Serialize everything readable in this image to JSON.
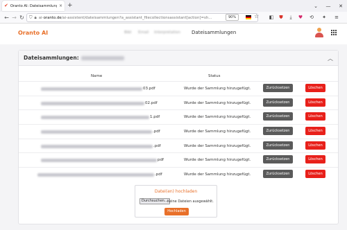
{
  "browser": {
    "tab_title": "Oranto AI: Dateisammlungen d...",
    "tab_close": "×",
    "new_tab": "+",
    "url_prefix": "ai-",
    "url_domain": "oranto.de",
    "url_rest": "/ai-assistent/dateisammlungen?a_assistant_filecollectionsassistant[action]=sh...",
    "zoom": "90%"
  },
  "app": {
    "brand": "Oranto AI",
    "nav": [
      "Bibl",
      "Email",
      "Interpretation"
    ],
    "active_nav": "Dateisammlungen"
  },
  "card": {
    "title": "Dateisammlungen:",
    "col_name": "Name",
    "col_status": "Status"
  },
  "rows": [
    {
      "suffix": "03.pdf",
      "status": "Wurde der Sammlung hinzugefügt.",
      "reset": "Zurücksetzen",
      "delete": "Löschen"
    },
    {
      "suffix": "02.pdf",
      "status": "Wurde der Sammlung hinzugefügt.",
      "reset": "Zurücksetzen",
      "delete": "Löschen"
    },
    {
      "suffix": "1.pdf",
      "status": "Wurde der Sammlung hinzugefügt.",
      "reset": "Zurücksetzen",
      "delete": "Löschen"
    },
    {
      "suffix": ".pdf",
      "status": "Wurde der Sammlung hinzugefügt.",
      "reset": "Zurücksetzen",
      "delete": "Löschen"
    },
    {
      "suffix": ".pdf",
      "status": "Wurde der Sammlung hinzugefügt.",
      "reset": "Zurücksetzen",
      "delete": "Löschen"
    },
    {
      "suffix": "pdf",
      "status": "Wurde der Sammlung hinzugefügt.",
      "reset": "Zurücksetzen",
      "delete": "Löschen"
    },
    {
      "suffix": ".pdf",
      "status": "Wurde der Sammlung hinzugefügt.",
      "reset": "Zurücksetzen",
      "delete": "Löschen"
    }
  ],
  "upload": {
    "title": "Datei(en) hochladen",
    "browse": "Durchsuchen...",
    "no_file": "Keine Dateien ausgewählt.",
    "submit": "Hochladen"
  },
  "colors": {
    "brand": "#e8702a",
    "delete": "#e8201a",
    "reset": "#5a5a5a"
  }
}
